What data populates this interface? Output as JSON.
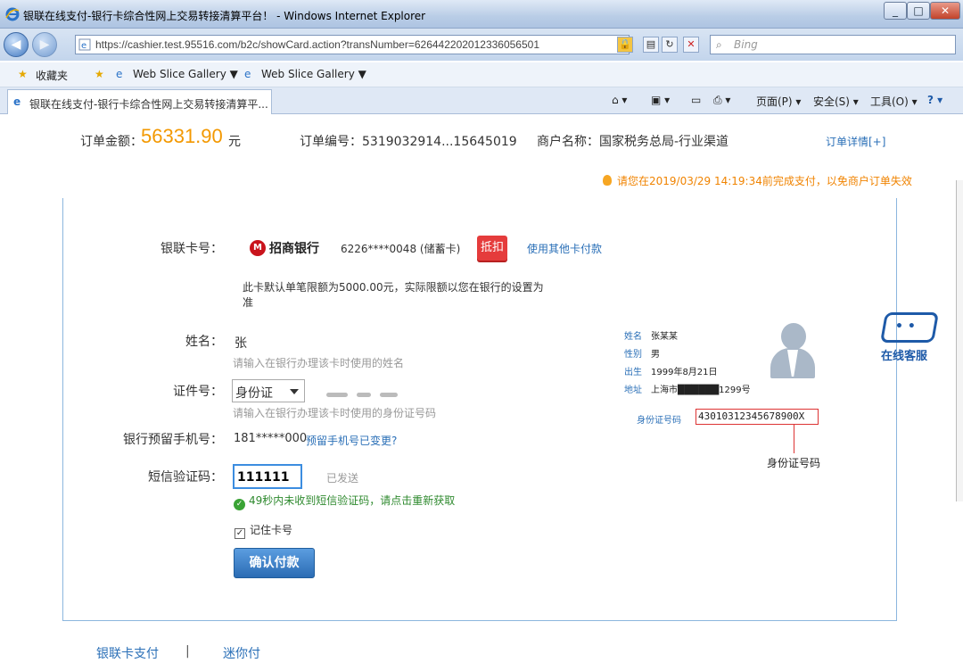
{
  "window": {
    "title": "银联在线支付-银行卡综合性网上交易转接清算平台！ - Windows Internet Explorer",
    "controls": {
      "minimize": "_",
      "maximize": "□",
      "close": "✕"
    }
  },
  "addressbar": {
    "url": "https://cashier.test.95516.com/b2c/showCard.action?transNumber=626442202012336056501",
    "search_placeholder": "Bing"
  },
  "favorites": {
    "label": "收藏夹",
    "items": [
      "Web Slice Gallery ▼",
      "Web Slice Gallery ▼"
    ]
  },
  "tabs": [
    {
      "label": "银联在线支付-银行卡综合性网上交易转接清算平..."
    }
  ],
  "commandbar": {
    "page": "页面(P) ▾",
    "safety": "安全(S) ▾",
    "tools": "工具(O) ▾"
  },
  "order": {
    "amount_label": "订单金额：",
    "amount": "56331.90",
    "unit": "元",
    "number": "订单编号：5319032914...15645019",
    "merchant": "商户名称：国家税务总局-行业渠道",
    "detail_link": "订单详情[+]",
    "deadline": "请您在2019/03/29 14:19:34前完成支付，以免商户订单失效"
  },
  "card": {
    "label": "银联卡号：",
    "bank_name": "招商银行",
    "bank_mark": "M",
    "number": "6226****0048 (储蓄卡)",
    "offset_badge": "抵扣",
    "other_card_link": "使用其他卡付款",
    "limit_note": "此卡默认单笔限额为5000.00元，实际限额以您在银行的设置为准"
  },
  "form": {
    "name_label": "姓名：",
    "name_value": "张",
    "name_hint": "请输入在银行办理该卡时使用的姓名",
    "id_label": "证件号：",
    "id_type": "身份证",
    "id_hint": "请输入在银行办理该卡时使用的身份证号码",
    "phone_label": "银行预留手机号：",
    "phone_value": "181*****000",
    "phone_change_link": "预留手机号已变更?",
    "sms_label": "短信验证码：",
    "sms_value": "111111",
    "sms_sent": "已发送",
    "sms_tip": "49秒内未收到短信验证码，请点击重新获取",
    "remember": "记住卡号",
    "confirm_button": "确认付款"
  },
  "idcard": {
    "name_k": "姓名",
    "name_v": "张某某",
    "gender_k": "性别",
    "gender_v": "男",
    "birth_k": "出生",
    "birth_v": "1999年8月21日",
    "addr_k": "地址",
    "addr_v": "上海市██████1299号",
    "idnum_label": "身份证号码",
    "idnum_value": "43010312345678900X",
    "caption": "身份证号码"
  },
  "service": {
    "label": "在线客服",
    "eyes": "• •"
  },
  "footer": {
    "unionpay": "银联卡支付",
    "separator": "|",
    "mini": "迷你付"
  }
}
